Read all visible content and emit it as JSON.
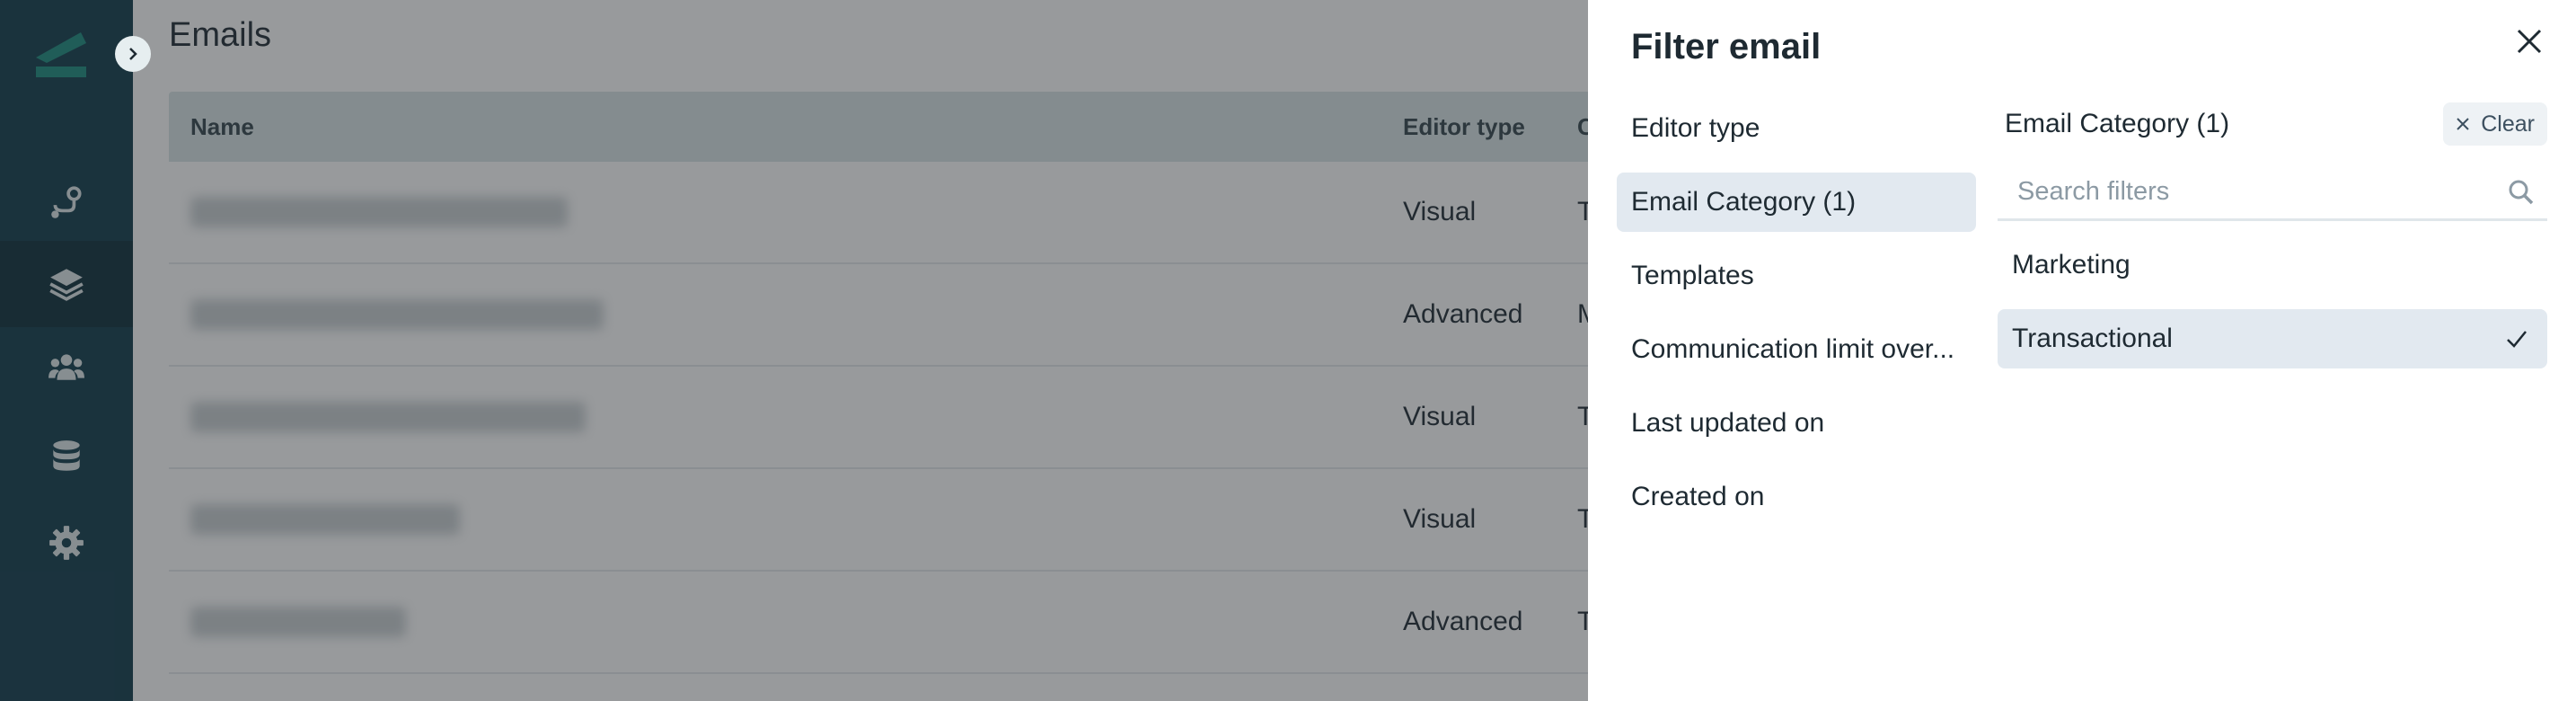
{
  "page": {
    "title": "Emails"
  },
  "nav": {
    "items": [
      {
        "name": "journeys",
        "icon": "route-icon"
      },
      {
        "name": "content",
        "icon": "layers-icon",
        "active": true
      },
      {
        "name": "audience",
        "icon": "users-icon"
      },
      {
        "name": "data",
        "icon": "database-icon"
      },
      {
        "name": "settings",
        "icon": "gear-icon"
      }
    ]
  },
  "table": {
    "columns": {
      "name": "Name",
      "editor": "Editor type",
      "category": "C"
    },
    "rows": [
      {
        "editor": "Visual",
        "category": "T"
      },
      {
        "editor": "Advanced",
        "category": "M"
      },
      {
        "editor": "Visual",
        "category": "T"
      },
      {
        "editor": "Visual",
        "category": "T"
      },
      {
        "editor": "Advanced",
        "category": "T"
      }
    ]
  },
  "filter": {
    "title": "Filter email",
    "categories": [
      "Editor type",
      "Email Category (1)",
      "Templates",
      "Communication limit over...",
      "Last updated on",
      "Created on"
    ],
    "active_category": "Email Category (1)",
    "options_title": "Email Category (1)",
    "clear_label": "Clear",
    "search_placeholder": "Search filters",
    "options": [
      {
        "label": "Marketing",
        "selected": false
      },
      {
        "label": "Transactional",
        "selected": true
      }
    ]
  },
  "colors": {
    "sidebar": "#0f3a4a",
    "accent": "#1a8a7d",
    "selected_bg": "#e2e9f0"
  }
}
